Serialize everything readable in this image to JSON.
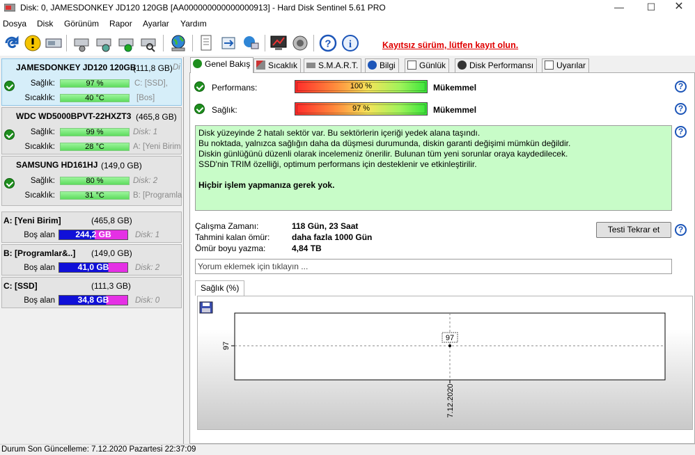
{
  "window": {
    "title": "Disk: 0, JAMESDONKEY JD120 120GB [AA000000000000000913]  -  Hard Disk Sentinel 5.61 PRO"
  },
  "menu": [
    "Dosya",
    "Disk",
    "Görünüm",
    "Rapor",
    "Ayarlar",
    "Yardım"
  ],
  "toolbar": {
    "registration": "Kayıtsız sürüm, lütfen kayıt olun."
  },
  "disks": [
    {
      "name": "JAMESDONKEY JD120 120GB",
      "size": "(111,8 GB)",
      "extra": "Di",
      "health_label": "Sağlık:",
      "health": "97 %",
      "temp_label": "Sıcaklık:",
      "temp": "40 °C",
      "c1": "C: [SSD],",
      "c2": "[Bos]",
      "health_frac": 0.97
    },
    {
      "name": "WDC WD5000BPVT-22HXZT3",
      "size": "(465,8 GB)",
      "extra": "",
      "health_label": "Sağlık:",
      "health": "99 %",
      "temp_label": "Sıcaklık:",
      "temp": "28 °C",
      "c1": "Disk: 1",
      "c2": "A: [Yeni Birim",
      "health_frac": 0.99
    },
    {
      "name": "SAMSUNG HD161HJ",
      "size": "(149,0 GB)",
      "extra": "",
      "health_label": "Sağlık:",
      "health": "80 %",
      "temp_label": "Sıcaklık:",
      "temp": "31 °C",
      "c1": "Disk: 2",
      "c2": "B: [Programla",
      "health_frac": 0.8
    }
  ],
  "volumes": [
    {
      "name": "A: [Yeni Birim]",
      "size": "(465,8 GB)",
      "label": "Boş alan",
      "free": "244,2 GB",
      "disk": "Disk: 1",
      "free_frac": 0.52
    },
    {
      "name": "B: [Programlar&..]",
      "size": "(149,0 GB)",
      "label": "Boş alan",
      "free": "41,0 GB",
      "disk": "Disk: 2",
      "free_frac": 0.28
    },
    {
      "name": "C: [SSD]",
      "size": "(111,3 GB)",
      "label": "Boş alan",
      "free": "34,8 GB",
      "disk": "Disk: 0",
      "free_frac": 0.31
    }
  ],
  "tabs": [
    "Genel Bakış",
    "Sıcaklık",
    "S.M.A.R.T.",
    "Bilgi",
    "Günlük",
    "Disk Performansı",
    "Uyarılar"
  ],
  "overview": {
    "perf_label": "Performans:",
    "perf_value": "100 %",
    "perf_text": "Mükemmel",
    "health_label": "Sağlık:",
    "health_value": "97 %",
    "health_text": "Mükemmel",
    "msg1": "Disk yüzeyinde 2 hatalı sektör var. Bu sektörlerin içeriği yedek alana taşındı.",
    "msg2": "Bu noktada, yalnızca sağlığın daha da düşmesi durumunda, diskin garanti değişimi mümkün değildir.",
    "msg3": "Diskin günlüğünü düzenli olarak incelemeniz önerilir. Bulunan tüm yeni sorunlar oraya kaydedilecek.",
    "msg4": "SSD'nin TRIM özelliği, optimum performans için desteklenir ve etkinleştirilir.",
    "msg5": "Hiçbir işlem yapmanıza gerek yok.",
    "uptime_label": "Çalışma Zamanı:",
    "uptime": "118 Gün, 23 Saat",
    "remain_label": "Tahmini kalan ömür:",
    "remain": "daha fazla 1000 Gün",
    "written_label": "Ömür boyu yazma:",
    "written": "4,84 TB",
    "retest": "Testi Tekrar et",
    "comment_placeholder": "Yorum eklemek için tıklayın ..."
  },
  "chart_data": {
    "type": "line",
    "tab": "Sağlık (%)",
    "x": [
      "7.12.2020"
    ],
    "values": [
      97
    ],
    "ytick": "97",
    "point_label": "97",
    "series": [
      {
        "values": [
          97
        ]
      }
    ]
  },
  "status": "Durum Son Güncelleme: 7.12.2020 Pazartesi 22:37:09",
  "colors": {
    "accent": "#1c55b8",
    "registration": "#e00000",
    "msgbg": "#c8fcc8"
  }
}
